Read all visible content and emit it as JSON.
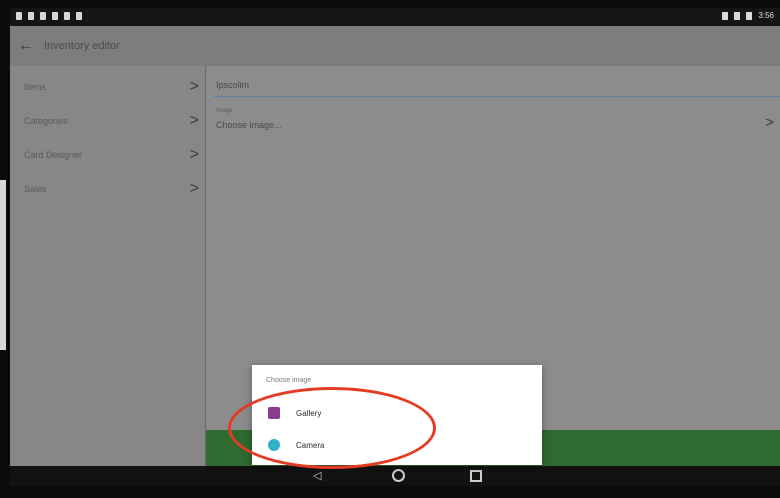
{
  "app": {
    "title": "Inventory editor"
  },
  "statusbar": {
    "time": "3:56",
    "left_icons": [
      "notification-icon",
      "notification-icon",
      "notification-icon",
      "notification-icon",
      "android-icon",
      "location-icon"
    ]
  },
  "sidebar": {
    "items": [
      {
        "label": "Items",
        "chevron": ">"
      },
      {
        "label": "Categories",
        "chevron": ">"
      },
      {
        "label": "Card Designer",
        "chevron": ">"
      },
      {
        "label": "Sales",
        "chevron": ">"
      }
    ]
  },
  "content": {
    "field_value": "Ipscolim",
    "image_label": "Image",
    "choose_image": "Choose image...",
    "chevron": ">"
  },
  "dialog": {
    "title": "Choose image",
    "options": [
      {
        "label": "Gallery",
        "icon": "gallery-icon"
      },
      {
        "label": "Camera",
        "icon": "camera-icon"
      }
    ]
  },
  "navbar": {
    "back_icon": "back-triangle-icon",
    "home_icon": "home-circle-icon",
    "recent_icon": "recent-square-icon"
  },
  "colors": {
    "highlight": "#e43b24",
    "accent_line": "#5e7fa3",
    "green_bar": "#2f6a30"
  }
}
